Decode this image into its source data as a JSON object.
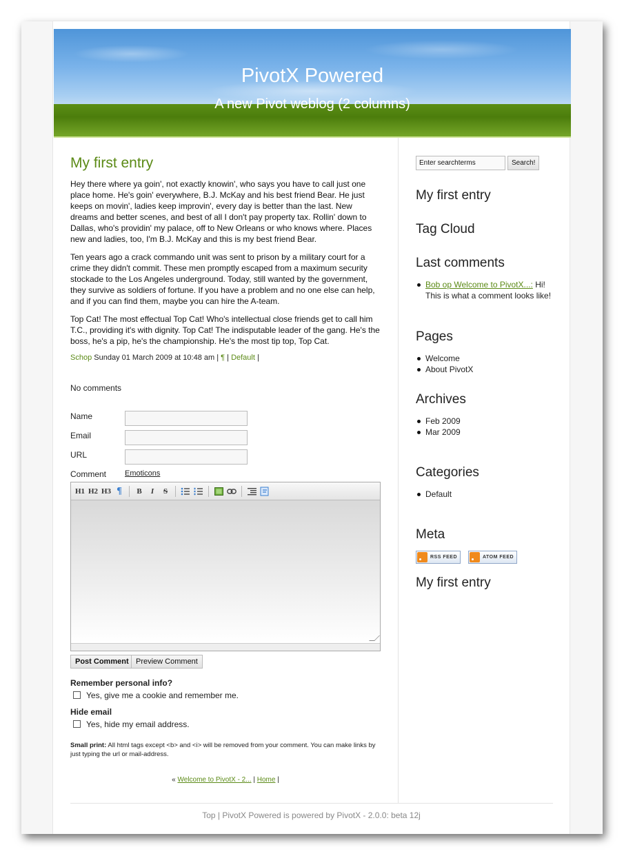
{
  "header": {
    "title": "PivotX Powered",
    "subtitle": "A new Pivot weblog (2 columns)"
  },
  "entry": {
    "title": "My first entry",
    "paragraphs": [
      "Hey there where ya goin', not exactly knowin', who says you have to call just one place home. He's goin' everywhere, B.J. McKay and his best friend Bear. He just keeps on movin', ladies keep improvin', every day is better than the last. New dreams and better scenes, and best of all I don't pay property tax. Rollin' down to Dallas, who's providin' my palace, off to New Orleans or who knows where. Places new and ladies, too, I'm B.J. McKay and this is my best friend Bear.",
      "Ten years ago a crack commando unit was sent to prison by a military court for a crime they didn't commit. These men promptly escaped from a maximum security stockade to the Los Angeles underground. Today, still wanted by the government, they survive as soldiers of fortune. If you have a problem and no one else can help, and if you can find them, maybe you can hire the A-team.",
      "Top Cat! The most effectual Top Cat! Who's intellectual close friends get to call him T.C., providing it's with dignity. Top Cat! The indisputable leader of the gang. He's the boss, he's a pip, he's the championship. He's the most tip top, Top Cat."
    ],
    "meta": {
      "author": "Schop",
      "date": "Sunday 01 March 2009 at 10:48 am",
      "sep1": "|",
      "permalink": "¶",
      "sep2": "|",
      "category": "Default",
      "sep3": "|"
    }
  },
  "comments": {
    "count_label": "No comments",
    "name_label": "Name",
    "email_label": "Email",
    "url_label": "URL",
    "comment_label": "Comment",
    "emoticons": "Emoticons",
    "toolbar": [
      "H1",
      "H2",
      "H3",
      "¶",
      "B",
      "I",
      "S"
    ],
    "post_button": "Post Comment",
    "preview_button": "Preview Comment",
    "remember_heading": "Remember personal info?",
    "remember_option": "Yes, give me a cookie and remember me.",
    "hide_heading": "Hide email",
    "hide_option": "Yes, hide my email address.",
    "smallprint_label": "Small print:",
    "smallprint_text": "All html tags except <b> and <i> will be removed from your comment. You can make links by just typing the url or mail-address."
  },
  "nav": {
    "prev_marker": "«",
    "prev_link": "Welcome to PivotX - 2...",
    "sep1": "|",
    "home": "Home",
    "sep2": "|"
  },
  "footer": "Top | PivotX Powered is powered by PivotX - 2.0.0: beta 12j",
  "sidebar": {
    "search_placeholder": "Enter searchterms",
    "search_button": "Search!",
    "headings": {
      "latest": "My first entry",
      "tagcloud": "Tag Cloud",
      "lastcomments": "Last comments",
      "pages": "Pages",
      "archives": "Archives",
      "categories": "Categories",
      "meta": "Meta",
      "bottom_entry": "My first entry"
    },
    "last_comment": {
      "link": "Bob op Welcome to PivotX...:",
      "text": " Hi! This is what a comment looks like!"
    },
    "pages": [
      "Welcome",
      "About PivotX"
    ],
    "archives": [
      "Feb 2009",
      "Mar 2009"
    ],
    "categories": [
      "Default"
    ],
    "feeds": [
      "RSS FEED",
      "ATOM FEED"
    ]
  },
  "colors": {
    "accent": "#5b8a16",
    "sky": "#7ab3ea",
    "grass": "#5a8c12"
  }
}
